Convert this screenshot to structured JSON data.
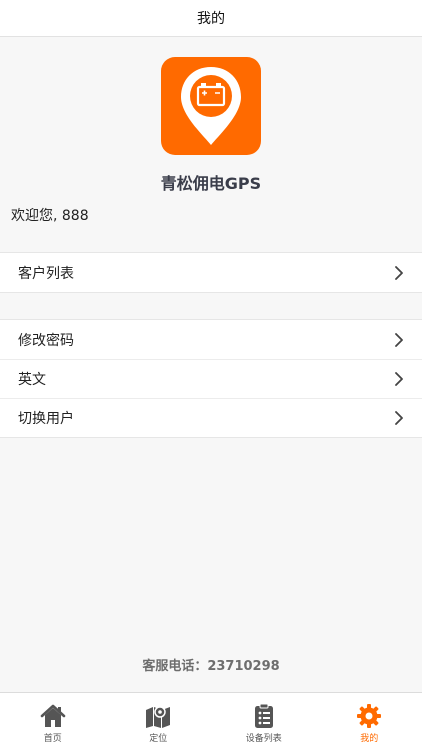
{
  "navbar": {
    "title": "我的"
  },
  "profile": {
    "app_name": "青松佣电GPS",
    "welcome": "欢迎您, 888",
    "logo_icon": "battery-location-pin-icon"
  },
  "menu_group_1": [
    {
      "label": "客户列表"
    }
  ],
  "menu_group_2": [
    {
      "label": "修改密码"
    },
    {
      "label": "英文"
    },
    {
      "label": "切换用户"
    }
  ],
  "support": {
    "hotline": "客服电话：23710298"
  },
  "tabs": [
    {
      "label": "首页",
      "icon": "home-icon",
      "active": false
    },
    {
      "label": "定位",
      "icon": "map-icon",
      "active": false
    },
    {
      "label": "设备列表",
      "icon": "clipboard-list-icon",
      "active": false
    },
    {
      "label": "我的",
      "icon": "gear-icon",
      "active": true
    }
  ],
  "colors": {
    "accent": "#ff6a00",
    "tab_inactive": "#555555",
    "background": "#f7f7f7"
  }
}
